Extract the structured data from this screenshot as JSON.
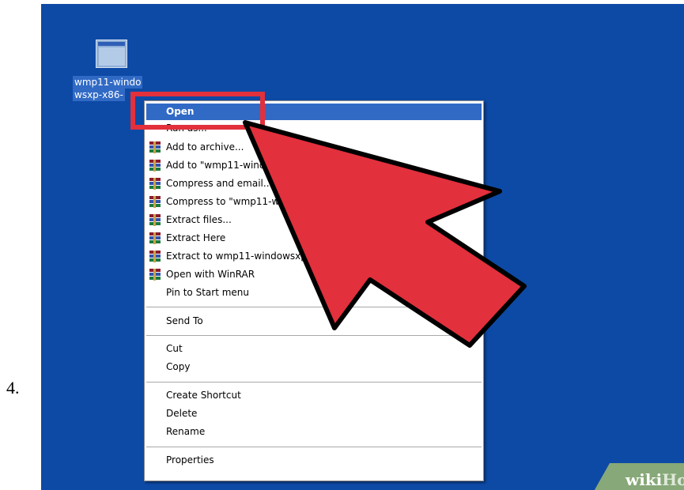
{
  "step_number": "4.",
  "desktop": {
    "file_icon": {
      "name": "wmp11-windowsxp-x86-...",
      "label_line1": "wmp11-windo",
      "label_line2": "wsxp-x86-"
    },
    "colors": {
      "desktop": "#0d4aa6",
      "selection": "#316ac5",
      "callout": "#e2303c"
    }
  },
  "context_menu": {
    "items": [
      {
        "label": "Open",
        "bold": true,
        "highlighted": true,
        "icon": null
      },
      {
        "label": "Run as...",
        "icon": null
      },
      {
        "label": "Add to archive...",
        "icon": "winrar-icon"
      },
      {
        "label": "Add to \"wmp11-windowsxp",
        "icon": "winrar-icon"
      },
      {
        "label": "Compress and email...",
        "icon": "winrar-icon"
      },
      {
        "label": "Compress to \"wmp11-windows",
        "icon": "winrar-icon"
      },
      {
        "label": "Extract files...",
        "icon": "winrar-icon"
      },
      {
        "label": "Extract Here",
        "icon": "winrar-icon"
      },
      {
        "label": "Extract to wmp11-windowsxp-x86-e",
        "icon": "winrar-icon"
      },
      {
        "label": "Open with WinRAR",
        "icon": "winrar-icon"
      },
      {
        "label": "Pin to Start menu",
        "icon": null
      },
      {
        "label": "Send To",
        "icon": null,
        "submenu_arrow": "▸"
      },
      {
        "label": "Cut",
        "icon": null
      },
      {
        "label": "Copy",
        "icon": null
      },
      {
        "label": "Create Shortcut",
        "icon": null
      },
      {
        "label": "Delete",
        "icon": null
      },
      {
        "label": "Rename",
        "icon": null
      },
      {
        "label": "Properties",
        "icon": null
      }
    ]
  },
  "watermark": {
    "prefix": "wiki",
    "suffix": "How"
  }
}
